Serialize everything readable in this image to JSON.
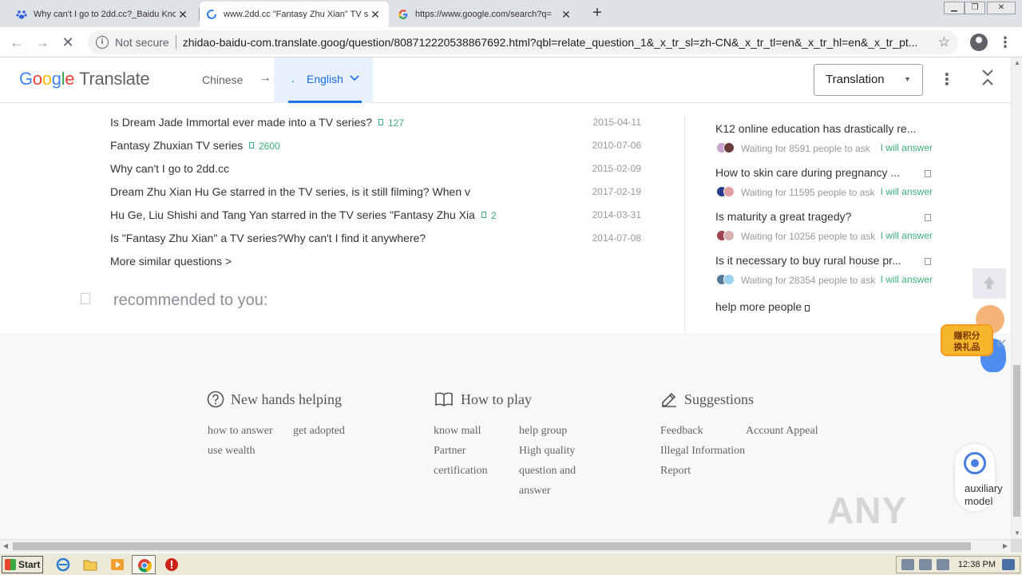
{
  "browser": {
    "tabs": [
      {
        "title": "Why can't I go to 2dd.cc?_Baidu Kno",
        "icon": "baidu-paw-icon",
        "active": false
      },
      {
        "title": "www.2dd.cc \"Fantasy Zhu Xian\" TV s",
        "icon": "loading-spinner-icon",
        "active": true
      },
      {
        "title": "https://www.google.com/search?q=",
        "icon": "google-g-icon",
        "active": false
      }
    ],
    "new_tab_label": "+",
    "security_label": "Not secure",
    "url": "zhidao-baidu-com.translate.goog/question/808712220538867692.html?qbl=relate_question_1&_x_tr_sl=zh-CN&_x_tr_tl=en&_x_tr_hl=en&_x_tr_pt..."
  },
  "translate_bar": {
    "logo_google": "Google",
    "logo_translate": "Translate",
    "source_lang": "Chinese",
    "arrow": "→",
    "target_lang": "English",
    "target_marker": ".",
    "mode_select": "Translation",
    "colors": {
      "accent": "#1a73e8",
      "accent_bg": "#e8f0fe"
    }
  },
  "related_questions": [
    {
      "text": "Is Dream Jade Immortal ever made into a TV series?",
      "count": "127",
      "date": "2015-04-11"
    },
    {
      "text": "Fantasy Zhuxian TV series",
      "count": "2600",
      "date": "2010-07-06"
    },
    {
      "text": "Why can't I go to 2dd.cc",
      "count": "",
      "date": "2015-02-09"
    },
    {
      "text": "Dream Zhu Xian Hu Ge starred in the TV series, is it still filming? When v",
      "count": "",
      "date": "2017-02-19"
    },
    {
      "text": "Hu Ge, Liu Shishi and Tang Yan starred in the TV series \"Fantasy Zhu Xia",
      "count": "2",
      "date": "2014-03-31"
    },
    {
      "text": "Is \"Fantasy Zhu Xian\" a TV series?Why can't I find it anywhere?",
      "count": "",
      "date": "2014-07-08"
    }
  ],
  "more_similar": "More similar questions  >",
  "recommended_title": "recommended to you:",
  "sidebar": {
    "questions": [
      {
        "title": "K12 online education has drastically re...",
        "waiting": "Waiting for 8591  people to ask",
        "answer": "I will answer"
      },
      {
        "title": "How to skin care during pregnancy ...",
        "waiting": "Waiting for 11595  people to ask",
        "answer": "I will answer"
      },
      {
        "title": "Is maturity a great tragedy?",
        "waiting": "Waiting for 10256  people to ask",
        "answer": "I will answer"
      },
      {
        "title": "Is it necessary to buy rural house pr...",
        "waiting": "Waiting for 28354  people to ask",
        "answer": "I will answer"
      }
    ],
    "help_more": "help more people"
  },
  "footer": {
    "columns": [
      {
        "title": "New hands helping",
        "icon": "question-circle-icon",
        "links": [
          "how to answer",
          "get adopted",
          "use wealth"
        ]
      },
      {
        "title": "How to play",
        "icon": "open-book-icon",
        "links": [
          "know mall",
          "help group",
          "Partner",
          "High quality",
          "certification",
          "question and",
          "answer"
        ]
      },
      {
        "title": "Suggestions",
        "icon": "pencil-icon",
        "links": [
          "Feedback",
          "Account Appeal",
          "Illegal Information",
          "Report"
        ]
      }
    ]
  },
  "floating": {
    "promo_text": "赚积分\n换礼品",
    "aux_label": "auxiliary model"
  },
  "watermark": "ANY RUN",
  "taskbar": {
    "start_label": "Start",
    "clock": "12:38 PM"
  }
}
